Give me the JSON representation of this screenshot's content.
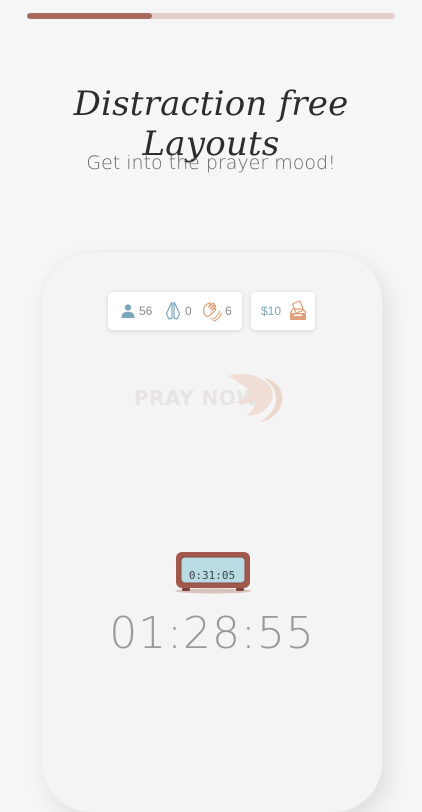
{
  "progress": {
    "fraction": 0.34
  },
  "headline": "Distraction free Layouts",
  "subheadline": "Get into the prayer mood!",
  "stats": {
    "people_count": "56",
    "prayers_count": "0",
    "claps_count": "6"
  },
  "donate": {
    "amount": "$10"
  },
  "logo": {
    "text": "PRAY NOW"
  },
  "timer": {
    "device_display": "0:31:05",
    "main_display": "01:28:55"
  },
  "icons": {
    "people": "person-icon",
    "prayers": "praying-hands-icon",
    "claps": "clapping-hands-icon",
    "donate": "donation-box-icon",
    "logo": "dove-icon",
    "timer": "alarm-clock-icon"
  },
  "colors": {
    "progress_fill": "#a86b5f",
    "progress_track": "#e2cfc9",
    "icon_blue": "#7ba7be",
    "icon_orange": "#e0a07a",
    "timer_text": "#9a9898"
  }
}
